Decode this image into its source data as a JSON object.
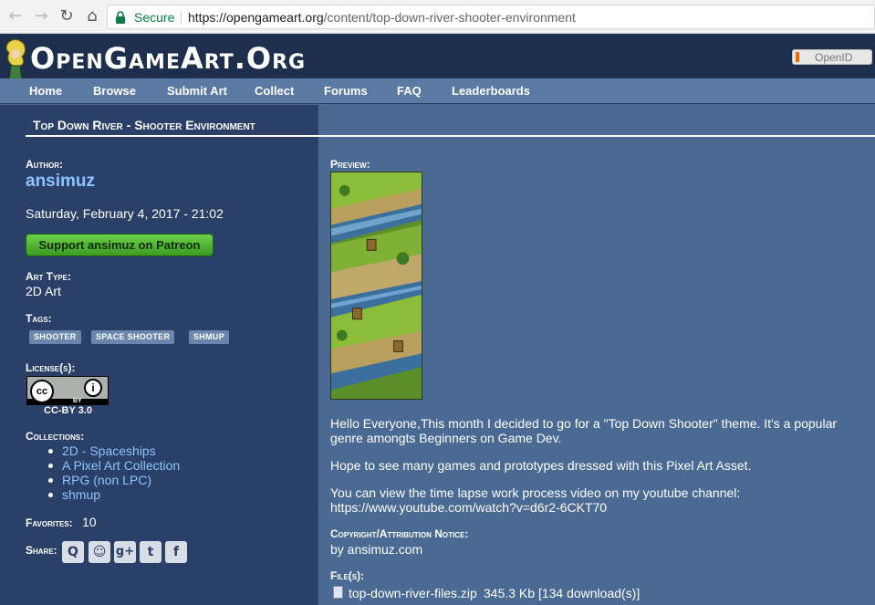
{
  "browser": {
    "nav": {
      "back": "←",
      "forward": "→",
      "reload": "↻",
      "home": "⌂"
    },
    "secure_label": "Secure",
    "url_host": "https://opengameart.org",
    "url_path": "/content/top-down-river-shooter-environment"
  },
  "site": {
    "title": "OpenGameArt.Org",
    "openid_label": "OpenID",
    "nav": [
      "Home",
      "Browse",
      "Submit Art",
      "Collect",
      "Forums",
      "FAQ",
      "Leaderboards"
    ]
  },
  "page": {
    "title": "Top Down River - Shooter Environment"
  },
  "sidebar": {
    "author_label": "Author:",
    "author_name": "ansimuz",
    "date": "Saturday, February 4, 2017 - 21:02",
    "patreon_label": "Support ansimuz on Patreon",
    "art_type_label": "Art Type:",
    "art_type": "2D Art",
    "tags_label": "Tags:",
    "tags": [
      "SHOOTER",
      "SPACE SHOOTER",
      "SHMUP"
    ],
    "license_label": "License(s):",
    "license_badge": {
      "cc": "cc",
      "by": "i",
      "by_text": "BY"
    },
    "license_caption": "CC-BY 3.0",
    "collections_label": "Collections:",
    "collections": [
      "2D - Spaceships",
      "A Pixel Art Collection",
      "RPG (non LPC)",
      "shmup"
    ],
    "favorites_label": "Favorites:",
    "favorites_count": "10",
    "share_label": "Share:",
    "share_icons": [
      "q-icon",
      "reddit-icon",
      "google-plus-icon",
      "twitter-icon",
      "facebook-icon"
    ],
    "share_glyphs": [
      "Q",
      "☺",
      "g+",
      "t",
      "f"
    ]
  },
  "main": {
    "preview_label": "Preview:",
    "para1": "Hello Everyone,This month I decided to go for a \"Top Down Shooter\" theme. It's a popular genre amongts Beginners on Game Dev.",
    "para2": "Hope to see many games and prototypes dressed with this Pixel Art Asset.",
    "para3": "You can view the time lapse work process video on my youtube channel:",
    "youtube_link": "https://www.youtube.com/watch?v=d6r2-6CKT70",
    "copyright_label": "Copyright/Attribution Notice:",
    "copyright_text": "by ansimuz.com",
    "files_label": "File(s):",
    "file_name": "top-down-river-files.zip",
    "file_meta": "345.3 Kb [134 download(s)]"
  },
  "colors": {
    "header_bg": "#1d2f4c",
    "nav_bg": "#5b7aa3",
    "sidebar_bg": "#2a4068",
    "content_bg": "#4a6a93",
    "link": "#8dc4ff",
    "patreon_green": "#4caf2a"
  }
}
